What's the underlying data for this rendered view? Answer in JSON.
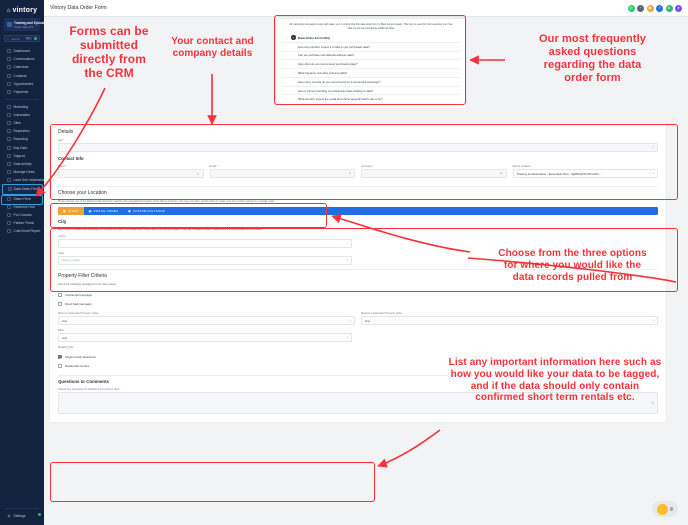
{
  "sidebar": {
    "brand": "vintory",
    "account": {
      "name": "Training and Educat...",
      "sub": "Cotton Bay 404",
      "caret": "chevron-down"
    },
    "search": {
      "placeholder": "Search",
      "shortcut": "⌘K"
    },
    "groups": [
      {
        "items": [
          {
            "label": "Dashboard",
            "icon": "dashboard-icon"
          },
          {
            "label": "Conversations",
            "icon": "chat-icon"
          },
          {
            "label": "Calendars",
            "icon": "calendar-icon"
          },
          {
            "label": "Contacts",
            "icon": "contacts-icon"
          },
          {
            "label": "Opportunities",
            "icon": "funnel-icon"
          },
          {
            "label": "Payments",
            "icon": "payments-icon"
          }
        ]
      },
      {
        "items": [
          {
            "label": "Marketing",
            "icon": "megaphone-icon"
          },
          {
            "label": "Automation",
            "icon": "automation-icon"
          },
          {
            "label": "Sites",
            "icon": "sites-icon"
          },
          {
            "label": "Reputation",
            "icon": "star-icon"
          },
          {
            "label": "Reporting",
            "icon": "chart-icon"
          },
          {
            "label": "Buy Data",
            "icon": "database-icon"
          },
          {
            "label": "Support",
            "icon": "support-icon"
          },
          {
            "label": "Data Activity",
            "icon": "activity-icon"
          },
          {
            "label": "Manage Deals",
            "icon": "deals-icon"
          },
          {
            "label": "Lead Gen Information",
            "icon": "info-icon"
          },
          {
            "label": "Data Order Form",
            "icon": "form-icon",
            "active": true
          },
          {
            "label": "Share Feed",
            "icon": "share-icon"
          },
          {
            "label": "Resource Hub",
            "icon": "hub-icon"
          },
          {
            "label": "Pro Courses",
            "icon": "courses-icon"
          },
          {
            "label": "Partner Portal",
            "icon": "portal-icon"
          },
          {
            "label": "Cold Email Report",
            "icon": "report-icon"
          }
        ]
      }
    ],
    "settings": {
      "label": "Settings",
      "icon": "gear-icon"
    }
  },
  "topbar": {
    "title": "Vintory Data Order Form",
    "icons": [
      {
        "name": "whatsapp-icon",
        "glyph": "✆",
        "color": "#25D366"
      },
      {
        "name": "notifications-icon",
        "glyph": "◔",
        "color": "#5b6676"
      },
      {
        "name": "apps-icon",
        "glyph": "▦",
        "color": "#f0a13c"
      },
      {
        "name": "help-icon",
        "glyph": "?",
        "color": "#1f6fe0"
      },
      {
        "name": "grid-icon",
        "glyph": "⊞",
        "color": "#2bb673"
      },
      {
        "name": "avatar-icon",
        "glyph": "●",
        "color": "#7c4dff"
      }
    ]
  },
  "faq": {
    "intro": "All marketing campaigns begin with data, so it is critical that this data order form is filled out accurately. This form is used for both selecting your free data as well as purchasing additional data.",
    "panel_title": "Data Order Form FAQ",
    "panel_badge": "?",
    "questions": [
      "How long should I expect it to take to get purchased data?",
      "Can we purchase international address data?",
      "How often do you recommend purchasing data?",
      "What happens next after ordering data?",
      "How many records do you recommend for a successful campaign?",
      "How is Vintory handling non-disclosure laws relating to data?",
      "What should I expect the email and phone append/match rate to be?"
    ]
  },
  "form": {
    "details": {
      "title": "Details",
      "site": {
        "label": "Site",
        "required": true,
        "value": "",
        "placeholder": ""
      }
    },
    "contact": {
      "title": "Contact Info",
      "name": {
        "label": "Name",
        "required": true,
        "value": "",
        "icon": "person-icon"
      },
      "email": {
        "label": "Email",
        "required": true,
        "value": "",
        "icon": "mail-icon"
      },
      "company": {
        "label": "Company",
        "required": true,
        "value": "",
        "icon": "building-icon"
      },
      "parent_location": {
        "label": "Parent Location",
        "required": false,
        "value": "Training and Education - Essentials Plan - AgRfNe5rXnOP1dzTo..."
      }
    },
    "location": {
      "title": "Choose your Location",
      "desc": "Please choose one of the following tabs below for selecting the geographical location of the data to pull from. You may use cities, postal codes or create your own custom polygons on google maps.",
      "tabs": [
        {
          "label": "CITIES",
          "icon": "city-icon",
          "active": true
        },
        {
          "label": "POSTAL CODES",
          "icon": "postal-icon",
          "active": false
        },
        {
          "label": "CUSTOM POLYGONS",
          "icon": "polygon-icon",
          "active": false
        }
      ],
      "city_section": {
        "title": "City",
        "desc": "Enter one or multiple cities separated by commas you want to pull data from. Cities must be in the same state. If they are in different states, please submit a second Data Order Request.",
        "cities": {
          "label": "City(s)",
          "value": "",
          "icon": "city-ico"
        },
        "state": {
          "label": "State",
          "value": "Select a State",
          "icon": "chevron-down-icon"
        }
      }
    },
    "filters": {
      "title": "Property Filter Criteria",
      "campaign_desc": "Check the marketing campaigns for the data request",
      "campaigns": [
        {
          "label": "Cold Email Campaign",
          "checked": false
        },
        {
          "label": "Direct Mail Campaign",
          "checked": false
        }
      ],
      "min_value": {
        "label": "Minimum Estimated Property Value",
        "value": "Any"
      },
      "max_value": {
        "label": "Maximum Estimated Property Value",
        "value": "Any"
      },
      "beds": {
        "label": "Beds",
        "value": "Any"
      },
      "property_type_label": "Property Type",
      "property_types": [
        {
          "label": "Single Family Residence",
          "checked": true
        },
        {
          "label": "Residential Condos",
          "checked": false
        }
      ]
    },
    "comments": {
      "title": "Questions or Comments",
      "label": "Submit Any Questions Or Additional Instructions Here",
      "value": "",
      "icon": "help-circle-icon"
    }
  },
  "annotations": {
    "accent_color": "#f8303a",
    "crm": "Forms can be\nsubmitted\ndirectly from\nthe CRM",
    "contact": "Your contact and\ncompany details",
    "faq": "Our most frequently\nasked questions\nregarding the data\norder form",
    "location": "Choose from the three options\nfor where you would like the\ndata records pulled from",
    "comments": "List any important information here such as\nhow you would like your data to be tagged,\nand if the data should only contain\nconfirmed short term rentals etc."
  },
  "chat": {
    "name": "chat-widget"
  }
}
